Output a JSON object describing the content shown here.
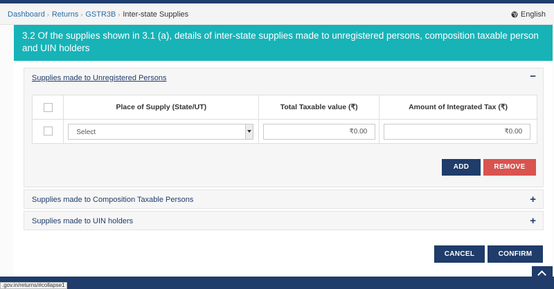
{
  "breadcrumb": {
    "items": [
      "Dashboard",
      "Returns",
      "GSTR3B"
    ],
    "current": "Inter-state Supplies"
  },
  "language": {
    "label": "English",
    "icon": "globe-icon"
  },
  "banner": {
    "text": "3.2 Of the supplies shown in 3.1 (a), details of inter-state supplies made to unregistered persons, composition taxable person and UIN holders"
  },
  "sections": {
    "unregistered": {
      "title": "Supplies made to Unregistered Persons",
      "toggle": "−",
      "table": {
        "headers": [
          "Place of Supply (State/UT)",
          "Total Taxable value (₹)",
          "Amount of Integrated Tax (₹)"
        ],
        "row": {
          "place_of_supply": "Select",
          "taxable_value": "₹0.00",
          "integrated_tax": "₹0.00"
        }
      },
      "add_label": "ADD",
      "remove_label": "REMOVE"
    },
    "composition": {
      "title": "Supplies made to Composition Taxable Persons",
      "toggle": "+"
    },
    "uin": {
      "title": "Supplies made to UIN holders",
      "toggle": "+"
    }
  },
  "actions": {
    "cancel_label": "CANCEL",
    "confirm_label": "CONFIRM"
  },
  "status_url": ".gov.in/returns/#collapse1",
  "colors": {
    "banner": "#17b3b7",
    "primary": "#1f3c6a",
    "danger": "#d9534f",
    "link": "#2b6ea6"
  }
}
